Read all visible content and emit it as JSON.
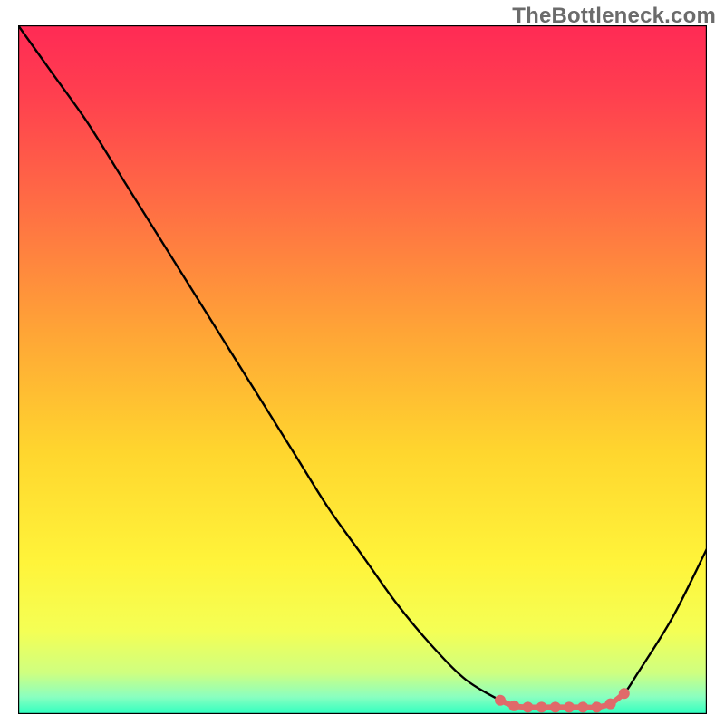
{
  "watermark": "TheBottleneck.com",
  "chart_data": {
    "type": "line",
    "title": "",
    "xlabel": "",
    "ylabel": "",
    "xlim": [
      0,
      100
    ],
    "ylim": [
      0,
      100
    ],
    "grid": false,
    "legend": false,
    "series": [
      {
        "name": "curve",
        "x": [
          0,
          5,
          10,
          15,
          20,
          25,
          30,
          35,
          40,
          45,
          50,
          55,
          60,
          65,
          70,
          72,
          74,
          76,
          78,
          80,
          82,
          84,
          86,
          88,
          90,
          95,
          100
        ],
        "y": [
          100,
          93,
          86,
          78,
          70,
          62,
          54,
          46,
          38,
          30,
          23,
          16,
          10,
          5,
          2,
          1.2,
          1,
          1,
          1,
          1,
          1,
          1,
          1.5,
          3,
          6,
          14,
          24
        ],
        "color": "#000000",
        "stroke_width": 2.4,
        "smooth": true
      },
      {
        "name": "marker-strip",
        "x": [
          70,
          72,
          74,
          76,
          78,
          80,
          82,
          84,
          86,
          88
        ],
        "y": [
          2.0,
          1.2,
          1.0,
          1.0,
          1.0,
          1.0,
          1.0,
          1.0,
          1.5,
          3.0
        ],
        "color": "#e06a6a",
        "stroke_width": 6,
        "smooth": true,
        "marker": true,
        "marker_radius": 6
      }
    ],
    "background_gradient": {
      "stops": [
        {
          "offset": 0.0,
          "color": "#ff2a55"
        },
        {
          "offset": 0.1,
          "color": "#ff3f4f"
        },
        {
          "offset": 0.25,
          "color": "#ff6a45"
        },
        {
          "offset": 0.45,
          "color": "#ffa636"
        },
        {
          "offset": 0.62,
          "color": "#ffd62e"
        },
        {
          "offset": 0.78,
          "color": "#fff43a"
        },
        {
          "offset": 0.88,
          "color": "#f4ff55"
        },
        {
          "offset": 0.94,
          "color": "#cfff80"
        },
        {
          "offset": 0.975,
          "color": "#8affc0"
        },
        {
          "offset": 1.0,
          "color": "#2dffc0"
        }
      ]
    },
    "axes_box": {
      "stroke": "#000000",
      "stroke_width": 2.4
    }
  }
}
